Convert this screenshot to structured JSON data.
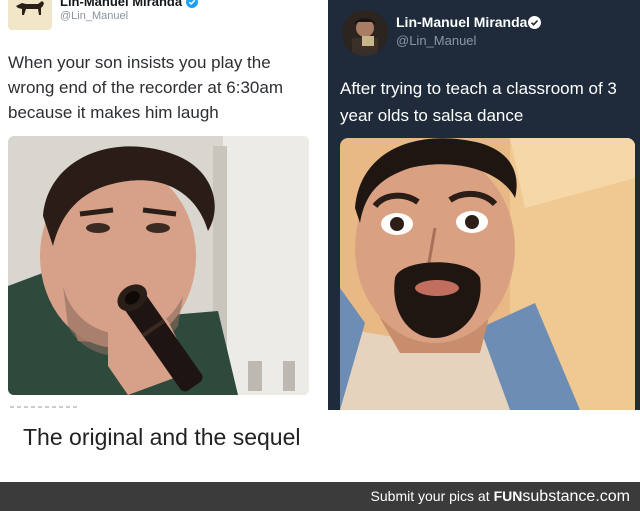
{
  "left_tweet": {
    "name": "Lin-Manuel Miranda",
    "handle": "@Lin_Manuel",
    "text": "When your son insists you play the wrong end of the recorder at 6:30am because it makes him laugh",
    "avatar_icon": "dog-silhouette-icon",
    "verified_icon": "verified-badge-icon",
    "verified_color": "#1da1f2"
  },
  "right_tweet": {
    "name": "Lin-Manuel Miranda",
    "handle": "@Lin_Manuel",
    "text": "After trying to teach a classroom of 3 year olds to salsa dance",
    "verified_icon": "verified-badge-icon",
    "background_color": "#1f2b3a"
  },
  "caption": "The original and the sequel",
  "footer": {
    "prefix": "Submit your pics at",
    "brand_part1": "FUN",
    "brand_part2": "substance",
    "brand_part3": ".com"
  }
}
